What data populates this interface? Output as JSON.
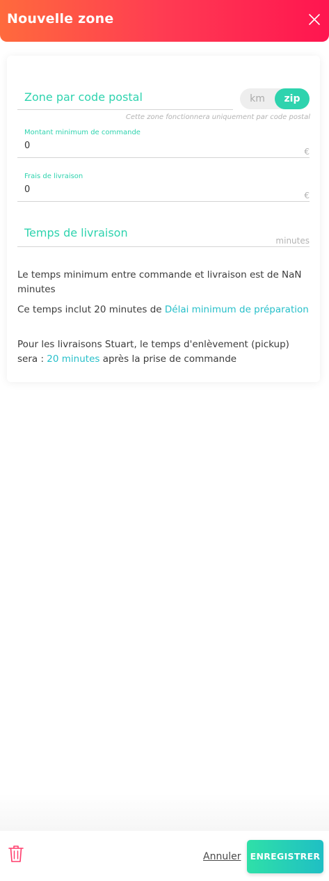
{
  "header": {
    "title": "Nouvelle zone"
  },
  "zone": {
    "name_value": "Zone par code postal",
    "toggle": {
      "km_label": "km",
      "zip_label": "zip",
      "selected": "zip"
    },
    "hint": "Cette zone fonctionnera uniquement par code postal"
  },
  "min_order": {
    "label": "Montant minimum de commande",
    "value": "0",
    "unit": "€"
  },
  "delivery_fee": {
    "label": "Frais de livraison",
    "value": "0",
    "unit": "€"
  },
  "delivery_time": {
    "label": "Temps de livraison",
    "unit": "minutes"
  },
  "info": {
    "p1": "Le temps minimum entre commande et livraison est de NaN minutes",
    "p2_prefix": "Ce temps inclut 20 minutes de ",
    "p2_link": "Délai minimum de préparation",
    "p3_prefix": "Pour les livraisons Stuart, le temps d'enlèvement (pickup) sera : ",
    "p3_link": "20 minutes",
    "p3_suffix": " après la prise de commande"
  },
  "footer": {
    "cancel_label": "Annuler",
    "save_label": "ENREGISTRER"
  },
  "colors": {
    "accent": "#2ed3ae",
    "link": "#25bfc9",
    "header_start": "#ff6a3d",
    "header_end": "#ff1550",
    "danger": "#ff3b6b"
  },
  "icons": {
    "close": "close-icon",
    "trash": "trash-icon"
  }
}
